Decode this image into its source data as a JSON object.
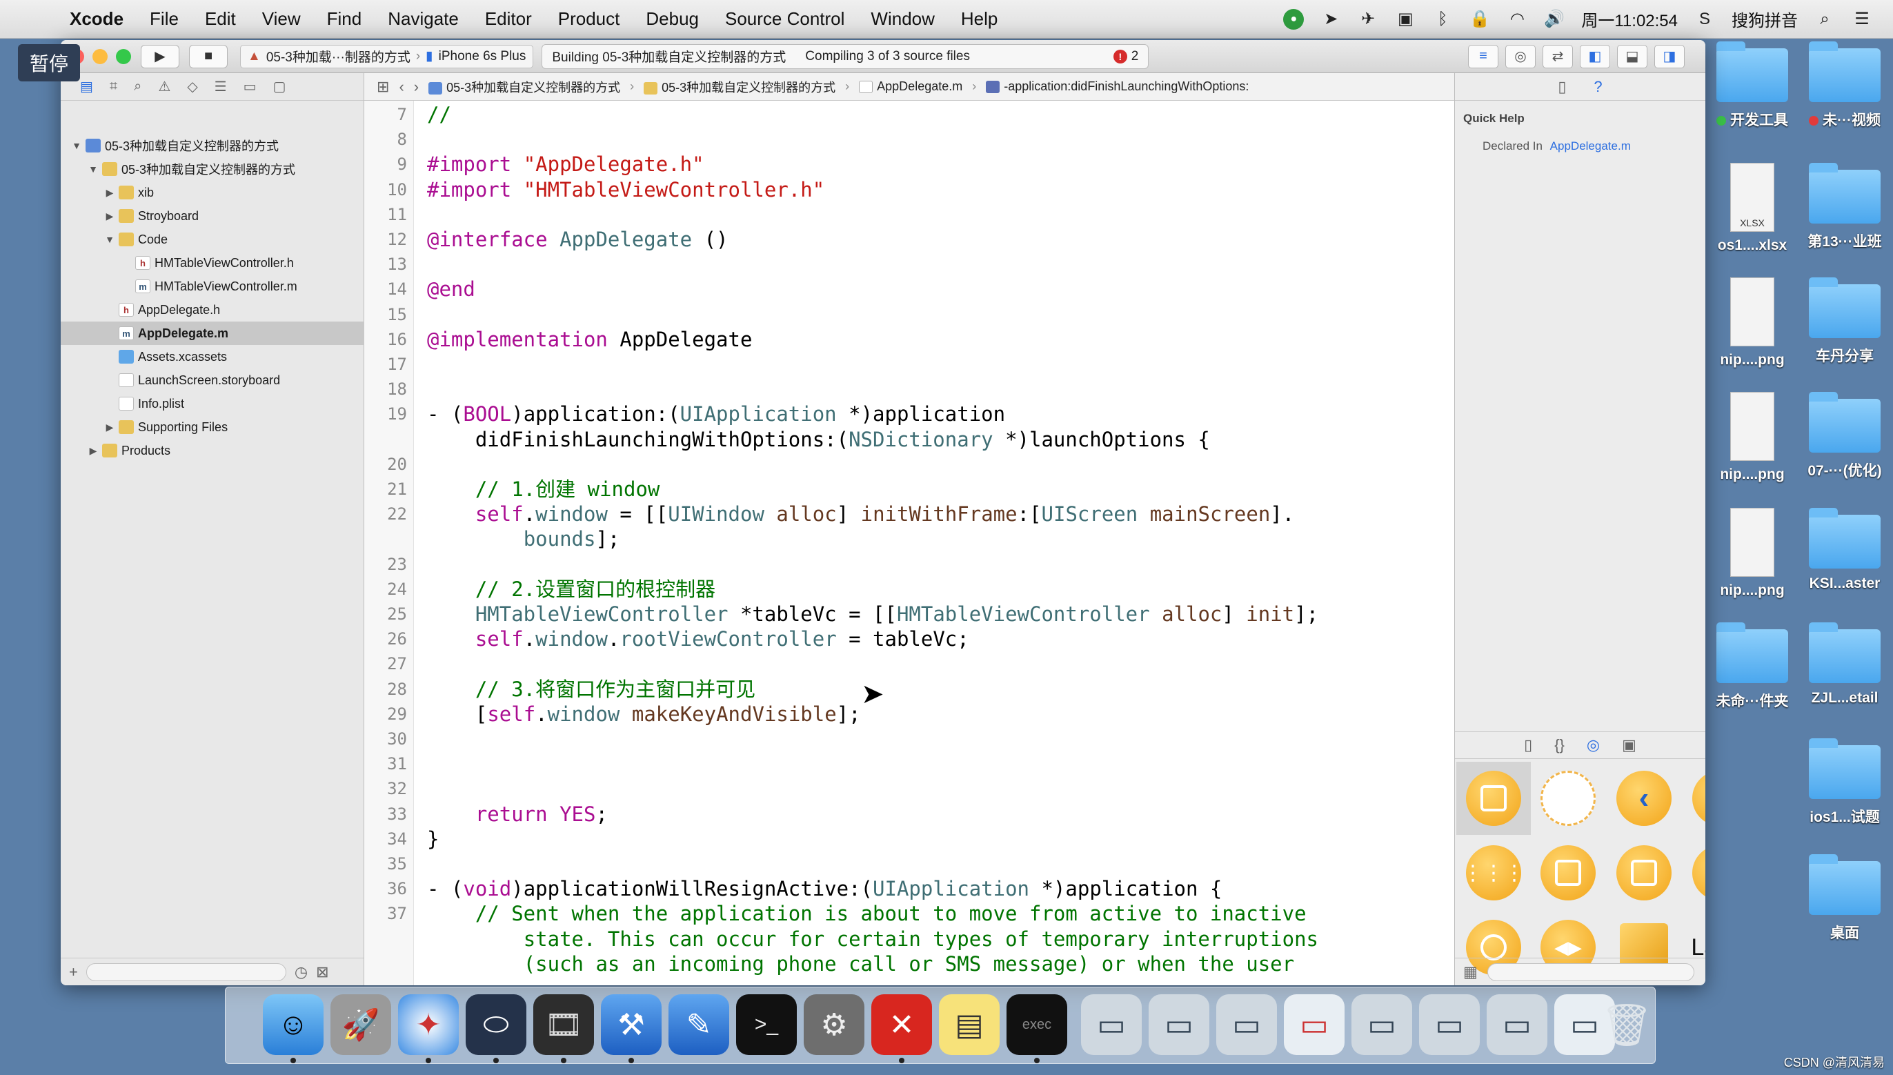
{
  "menubar": {
    "app": "Xcode",
    "items": [
      "File",
      "Edit",
      "View",
      "Find",
      "Navigate",
      "Editor",
      "Product",
      "Debug",
      "Source Control",
      "Window",
      "Help"
    ],
    "clock": "周一11:02:54",
    "input_method": "搜狗拼音"
  },
  "pause_badge": "暂停",
  "toolbar": {
    "scheme": "05-3种加载···制器的方式",
    "device": "iPhone 6s Plus",
    "activity_status": "Building 05-3种加载自定义控制器的方式",
    "activity_progress": "Compiling 3 of 3 source files",
    "error_count": "2"
  },
  "navigator": {
    "items": [
      {
        "label": "05-3种加载自定义控制器的方式",
        "kind": "proj",
        "depth": 0,
        "disc": "▼"
      },
      {
        "label": "05-3种加载自定义控制器的方式",
        "kind": "folder",
        "depth": 1,
        "disc": "▼"
      },
      {
        "label": "xib",
        "kind": "folder",
        "depth": 2,
        "disc": "▶"
      },
      {
        "label": "Stroyboard",
        "kind": "folder",
        "depth": 2,
        "disc": "▶"
      },
      {
        "label": "Code",
        "kind": "folder",
        "depth": 2,
        "disc": "▼"
      },
      {
        "label": "HMTableViewController.h",
        "kind": "hfile",
        "depth": 3,
        "disc": ""
      },
      {
        "label": "HMTableViewController.m",
        "kind": "mfile",
        "depth": 3,
        "disc": ""
      },
      {
        "label": "AppDelegate.h",
        "kind": "hfile",
        "depth": 2,
        "disc": ""
      },
      {
        "label": "AppDelegate.m",
        "kind": "mfile",
        "depth": 2,
        "disc": "",
        "selected": true
      },
      {
        "label": "Assets.xcassets",
        "kind": "assets",
        "depth": 2,
        "disc": ""
      },
      {
        "label": "LaunchScreen.storyboard",
        "kind": "story",
        "depth": 2,
        "disc": ""
      },
      {
        "label": "Info.plist",
        "kind": "plist",
        "depth": 2,
        "disc": ""
      },
      {
        "label": "Supporting Files",
        "kind": "folder",
        "depth": 2,
        "disc": "▶"
      },
      {
        "label": "Products",
        "kind": "folder",
        "depth": 1,
        "disc": "▶"
      }
    ]
  },
  "jumpbar": {
    "crumbs": [
      "05-3种加载自定义控制器的方式",
      "05-3种加载自定义控制器的方式",
      "AppDelegate.m",
      "-application:didFinishLaunchingWithOptions:"
    ]
  },
  "editor": {
    "lines": [
      {
        "n": "7",
        "html": "<span class=\"c\">//</span>"
      },
      {
        "n": "8",
        "html": ""
      },
      {
        "n": "9",
        "html": "<span class=\"k\">#import</span> <span class=\"s\">\"AppDelegate.h\"</span>"
      },
      {
        "n": "10",
        "html": "<span class=\"k\">#import</span> <span class=\"s\">\"HMTableViewController.h\"</span>"
      },
      {
        "n": "11",
        "html": ""
      },
      {
        "n": "12",
        "html": "<span class=\"k\">@interface</span> <span class=\"t\">AppDelegate</span> ()"
      },
      {
        "n": "13",
        "html": ""
      },
      {
        "n": "14",
        "html": "<span class=\"k\">@end</span>"
      },
      {
        "n": "15",
        "html": ""
      },
      {
        "n": "16",
        "html": "<span class=\"k\">@implementation</span> AppDelegate"
      },
      {
        "n": "17",
        "html": ""
      },
      {
        "n": "18",
        "html": ""
      },
      {
        "n": "19",
        "html": "- (<span class=\"k\">BOOL</span>)application:(<span class=\"t\">UIApplication</span> *)application"
      },
      {
        "n": "",
        "html": "    didFinishLaunchingWithOptions:(<span class=\"t\">NSDictionary</span> *)launchOptions {"
      },
      {
        "n": "20",
        "html": ""
      },
      {
        "n": "21",
        "html": "    <span class=\"c\">// 1.创建 window</span>"
      },
      {
        "n": "22",
        "html": "    <span class=\"k\">self</span>.<span class=\"t\">window</span> = [[<span class=\"t\">UIWindow</span> <span class=\"p\">alloc</span>] <span class=\"p\">initWithFrame</span>:[<span class=\"t\">UIScreen</span> <span class=\"p\">mainScreen</span>]."
      },
      {
        "n": "",
        "html": "        <span class=\"t\">bounds</span>];"
      },
      {
        "n": "23",
        "html": ""
      },
      {
        "n": "24",
        "html": "    <span class=\"c\">// 2.设置窗口的根控制器</span>"
      },
      {
        "n": "25",
        "html": "    <span class=\"t\">HMTableViewController</span> *tableVc = [[<span class=\"t\">HMTableViewController</span> <span class=\"p\">alloc</span>] <span class=\"p\">init</span>];"
      },
      {
        "n": "26",
        "html": "    <span class=\"k\">self</span>.<span class=\"t\">window</span>.<span class=\"t\">rootViewController</span> = tableVc;"
      },
      {
        "n": "27",
        "html": ""
      },
      {
        "n": "28",
        "html": "    <span class=\"c\">// 3.将窗口作为主窗口并可见</span>"
      },
      {
        "n": "29",
        "html": "    [<span class=\"k\">self</span>.<span class=\"t\">window</span> <span class=\"p\">makeKeyAndVisible</span>];"
      },
      {
        "n": "30",
        "html": ""
      },
      {
        "n": "31",
        "html": ""
      },
      {
        "n": "32",
        "html": ""
      },
      {
        "n": "33",
        "html": "    <span class=\"k\">return</span> <span class=\"k\">YES</span>;"
      },
      {
        "n": "34",
        "html": "}"
      },
      {
        "n": "35",
        "html": ""
      },
      {
        "n": "36",
        "html": "- (<span class=\"k\">void</span>)applicationWillResignActive:(<span class=\"t\">UIApplication</span> *)application {"
      },
      {
        "n": "37",
        "html": "    <span class=\"c\">// Sent when the application is about to move from active to inactive</span>"
      },
      {
        "n": "",
        "html": "        <span class=\"c\">state. This can occur for certain types of temporary interruptions</span>"
      },
      {
        "n": "",
        "html": "        <span class=\"c\">(such as an incoming phone call or SMS message) or when the user</span>"
      }
    ]
  },
  "quick_help": {
    "title": "Quick Help",
    "declared_in_label": "Declared In",
    "declared_in_value": "AppDelegate.m"
  },
  "library": {
    "last_cell_label": "Label"
  },
  "desktop": {
    "items": [
      {
        "label": "开发工具",
        "type": "folder",
        "dot": "#3ac048"
      },
      {
        "label": "未···视频",
        "type": "folder",
        "dot": "#e23b3b"
      },
      {
        "label": "os1....xlsx",
        "type": "doc",
        "doc_text": "XLSX"
      },
      {
        "label": "第13···业班",
        "type": "folder"
      },
      {
        "label": "nip....png",
        "type": "doc",
        "doc_text": ""
      },
      {
        "label": "车丹分享",
        "type": "folder"
      },
      {
        "label": "nip....png",
        "type": "doc",
        "doc_text": ""
      },
      {
        "label": "07-···(优化)",
        "type": "folder"
      },
      {
        "label": "nip....png",
        "type": "doc",
        "doc_text": ""
      },
      {
        "label": "KSI...aster",
        "type": "folder"
      },
      {
        "label": "未命···件夹",
        "type": "folder"
      },
      {
        "label": "ZJL...etail",
        "type": "folder"
      },
      {
        "label": "ios1...试题",
        "type": "folder"
      },
      {
        "label": "桌面",
        "type": "folder"
      }
    ]
  },
  "watermark": "CSDN @清风清易",
  "colors": {
    "keyword": "#aa0d91",
    "string": "#c41a16",
    "comment": "#007400",
    "type": "#3f6e74",
    "accent": "#2d6fe0"
  }
}
